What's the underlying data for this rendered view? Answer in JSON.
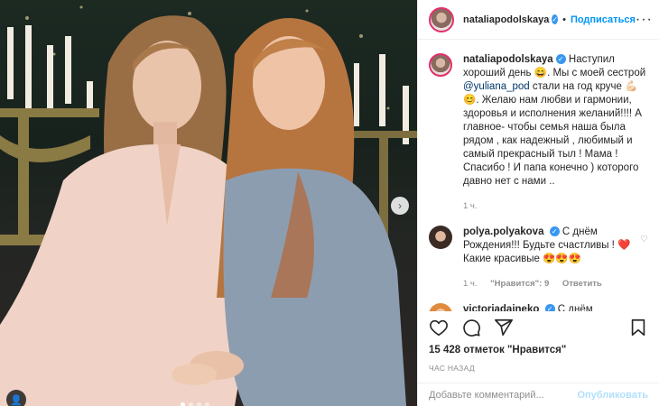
{
  "post": {
    "username": "nataliapodolskaya",
    "follow_label": "Подписаться",
    "separator": "•",
    "more_label": "···",
    "caption_parts": [
      "Наступил хороший день ",
      "😄",
      ". Мы с моей сестрой ",
      "@yuliana_pod",
      " стали на год круче ",
      "💪🏻😊",
      ". Желаю нам любви и гармонии, здоровья и исполнения желаний!!!! А главное- чтобы семья наша была рядом , как надежный , любимый и самый прекрасный тыл ! Мама ! Спасибо ! И папа конечно ) которого давно нет с нами .."
    ],
    "caption_time": "1 ч.",
    "likes": "15 428 отметок \"Нравится\"",
    "posted_ago": "час назад",
    "comment_placeholder": "Добавьте комментарий...",
    "publish_label": "Опубликовать"
  },
  "comments": [
    {
      "username": "polya.polyakova",
      "text_parts": [
        "С днём Рождения!!! Будьте счастливы ! ",
        "❤️",
        "Какие красивые ",
        "😍😍😍"
      ],
      "time": "1 ч.",
      "likes": "\"Нравится\": 9",
      "reply_label": "Ответить"
    },
    {
      "username": "victoriadaineko",
      "text_parts": [
        "С днём",
        "❤️❤️❤️"
      ]
    }
  ],
  "icons": {
    "verified": "verified-badge-icon",
    "heart": "heart-icon",
    "comment": "comment-icon",
    "share": "share-icon",
    "save": "bookmark-icon",
    "next": "chevron-right-icon",
    "tag": "user-tag-icon"
  },
  "colors": {
    "link": "#0095f6",
    "verified": "#3897f0",
    "muted": "#8e8e8e"
  }
}
